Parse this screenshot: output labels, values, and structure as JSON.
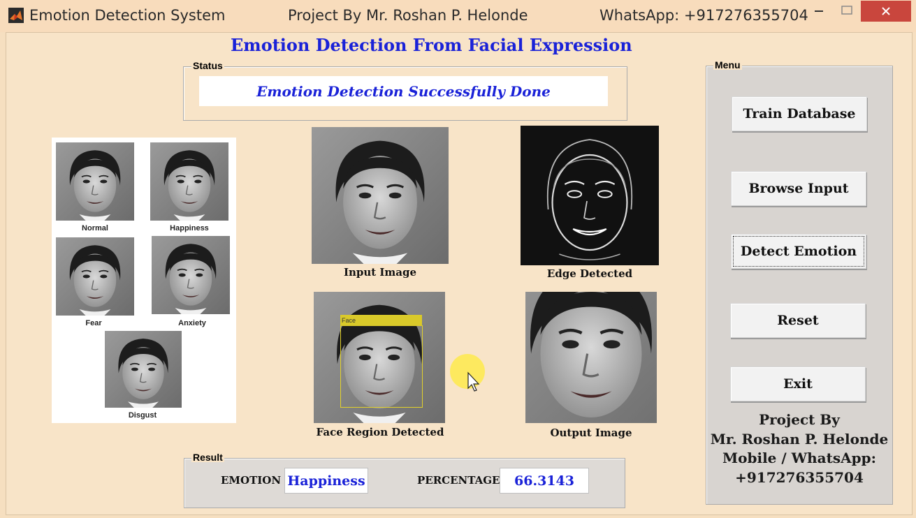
{
  "window": {
    "title": "Emotion Detection System",
    "project_by": "Project By Mr. Roshan P. Helonde",
    "whatsapp": "WhatsApp: +917276355704"
  },
  "heading": "Emotion Detection From Facial Expression",
  "status": {
    "label": "Status",
    "text": "Emotion Detection Successfully Done"
  },
  "reference": {
    "captions": [
      "Normal",
      "Happiness",
      "Fear",
      "Anxiety",
      "Disgust"
    ]
  },
  "images": {
    "input_caption": "Input Image",
    "edge_caption": "Edge Detected",
    "face_caption": "Face Region Detected",
    "face_box_label": "Face",
    "output_caption": "Output Image"
  },
  "menu": {
    "label": "Menu",
    "buttons": [
      "Train Database",
      "Browse Input",
      "Detect Emotion",
      "Reset",
      "Exit"
    ]
  },
  "credit": {
    "line1": "Project By",
    "line2": "Mr. Roshan P. Helonde",
    "line3": "Mobile / WhatsApp:",
    "line4": "+917276355704"
  },
  "result": {
    "label": "Result",
    "emotion_label": "EMOTION",
    "emotion_value": "Happiness",
    "percentage_label": "PERCENTAGE",
    "percentage_value": "66.3143"
  },
  "colors": {
    "accent": "#1a22d8",
    "background": "#f8e4c8",
    "close_button": "#c9463d"
  }
}
